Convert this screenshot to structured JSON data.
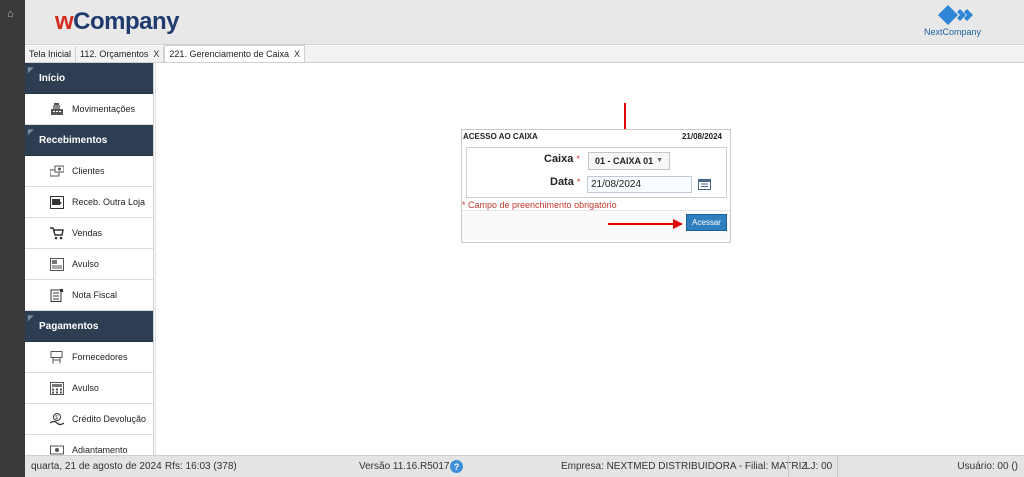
{
  "header": {
    "logo_w": "w",
    "logo_rest": "Company",
    "partner_logo": "NextCompany"
  },
  "tabs": [
    {
      "label": "Tela Inicial",
      "closable": false
    },
    {
      "label": "112. Orçamentos",
      "closable": true
    },
    {
      "label": "221. Gerenciamento de Caixa",
      "closable": true,
      "active": true
    }
  ],
  "close_glyph": "X",
  "sidebar": {
    "sections": [
      {
        "label": "Início",
        "items": [
          {
            "label": "Movimentações",
            "icon": "cash-register-icon"
          }
        ]
      },
      {
        "label": "Recebimentos",
        "items": [
          {
            "label": "Clientes",
            "icon": "clients-icon"
          },
          {
            "label": "Receb. Outra Loja",
            "icon": "store-transfer-icon"
          },
          {
            "label": "Vendas",
            "icon": "cart-icon"
          },
          {
            "label": "Avulso",
            "icon": "receipt-icon"
          },
          {
            "label": "Nota Fiscal",
            "icon": "invoice-icon"
          }
        ]
      },
      {
        "label": "Pagamentos",
        "items": [
          {
            "label": "Fornecedores",
            "icon": "supplier-icon"
          },
          {
            "label": "Avulso",
            "icon": "calculator-icon"
          },
          {
            "label": "Crédito Devolução",
            "icon": "refund-icon"
          },
          {
            "label": "Adiantamento",
            "icon": "advance-icon"
          }
        ]
      }
    ]
  },
  "dialog": {
    "title": "ACESSO AO CAIXA",
    "date": "21/08/2024",
    "caixa_label": "Caixa",
    "caixa_value": "01 - CAIXA 01",
    "data_label": "Data",
    "data_value": "21/08/2024",
    "required_mark": "*",
    "required_note": "* Campo de preenchimento obrigatório",
    "submit_label": "Acessar"
  },
  "footer": {
    "date_text": "quarta, 21 de agosto de 2024",
    "rfs_text": "Rfs: 16:03 (378)",
    "version_text": "Versão 11.16.R5017",
    "help_glyph": "?",
    "company_text": "Empresa: NEXTMED DISTRIBUIDORA - Filial: MATRIZ",
    "lj_text": "LJ: 00",
    "user_text": "Usuário: 00 ()"
  },
  "colors": {
    "sidebar_section": "#2e3e52",
    "primary_button": "#2f7fbf",
    "required": "#c0392b",
    "annotation_arrow": "#e00000"
  }
}
